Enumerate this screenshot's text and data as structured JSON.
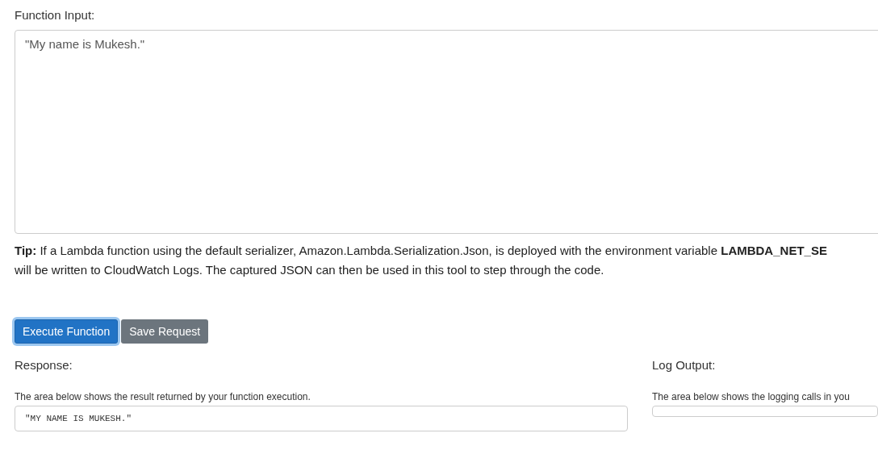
{
  "function_input": {
    "label": "Function Input:",
    "value": "\"My name is Mukesh.\""
  },
  "tip": "**Tip:** If a Lambda function using the default serializer, Amazon.Lambda.Serialization.Json, is deployed with the environment variable **LAMBDA_NET_SE**\nwill be written to CloudWatch Logs. The captured JSON can then be used in this tool to step through the code.",
  "buttons": [
    {
      "label": "Execute Function",
      "kind": "primary",
      "focused": true
    },
    {
      "label": "Save Request",
      "kind": "secondary",
      "focused": false
    }
  ],
  "response": {
    "label": "Response:",
    "description": "The area below shows the result returned by your function execution.",
    "value": "\"MY NAME IS MUKESH.\""
  },
  "log_output": {
    "label": "Log Output:",
    "description": "The area below shows the logging calls in you"
  }
}
